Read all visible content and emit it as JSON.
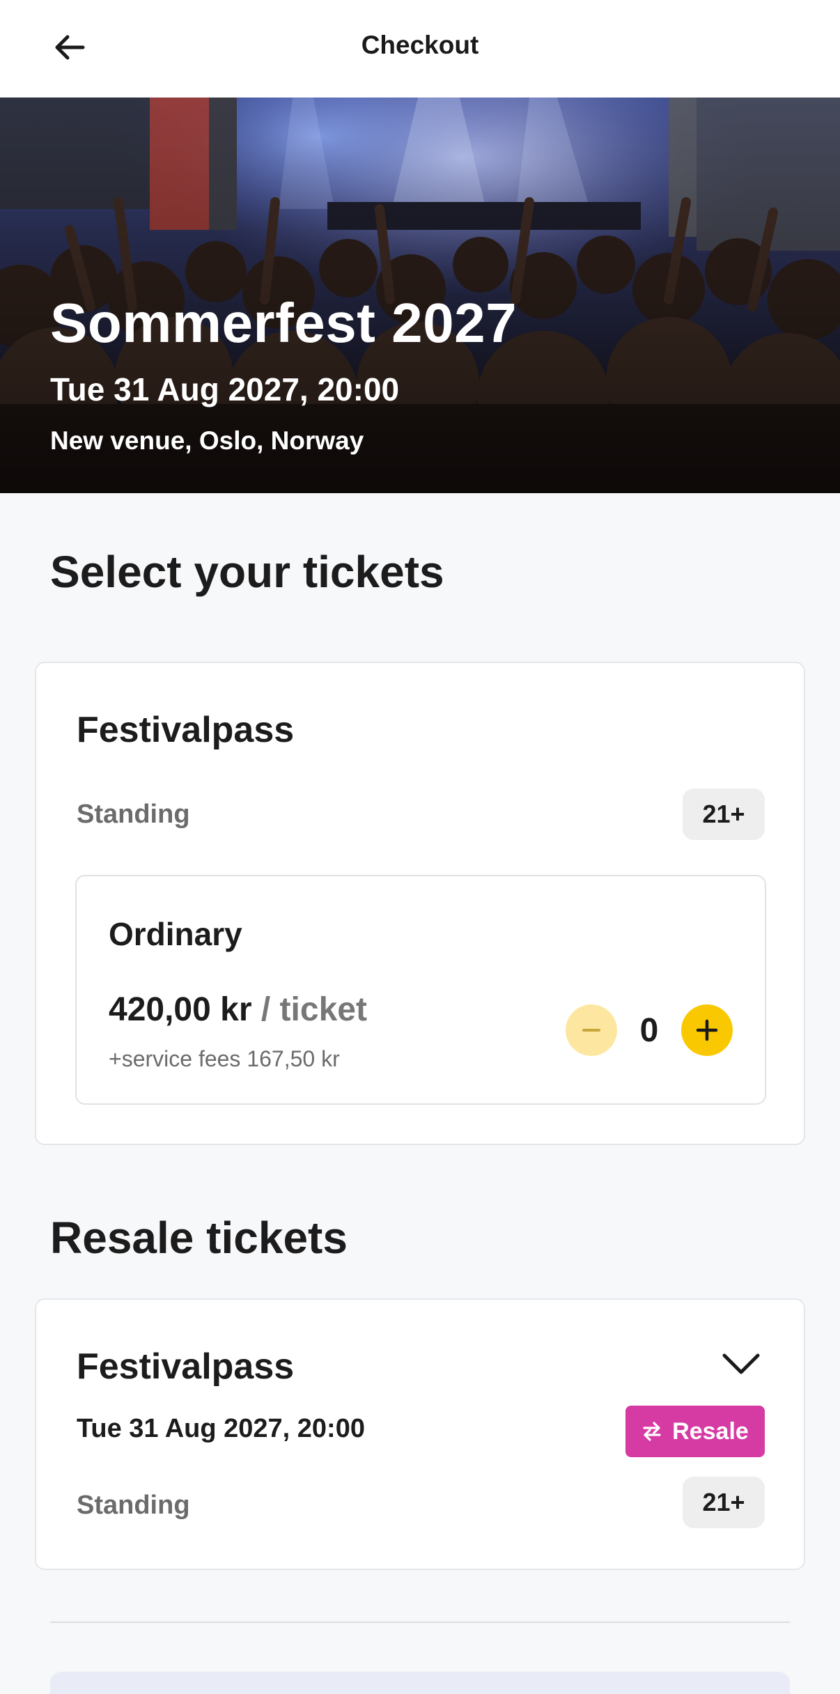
{
  "header": {
    "title": "Checkout"
  },
  "event": {
    "name": "Sommerfest 2027",
    "datetime": "Tue 31 Aug 2027, 20:00",
    "venue": "New venue, Oslo, Norway"
  },
  "tickets_section": {
    "title": "Select your tickets",
    "card": {
      "title": "Festivalpass",
      "type_label": "Standing",
      "age_badge": "21+",
      "option": {
        "name": "Ordinary",
        "price": "420,00 kr",
        "per_ticket": "/ ticket",
        "fees": "+service fees 167,50 kr",
        "quantity": "0",
        "minus_icon": "minus-icon",
        "plus_icon": "plus-icon"
      }
    }
  },
  "resale_section": {
    "title": "Resale tickets",
    "card": {
      "title": "Festivalpass",
      "datetime": "Tue 31 Aug 2027, 20:00",
      "badge_label": "Resale",
      "badge_icon": "swap-arrows-icon",
      "type_label": "Standing",
      "age_badge": "21+",
      "expand_icon": "chevron-down-icon"
    }
  },
  "colors": {
    "accent_yellow": "#f9c800",
    "accent_yellow_light": "#fde7a0",
    "resale_pink": "#d63aa3",
    "background": "#f7f8fa"
  }
}
